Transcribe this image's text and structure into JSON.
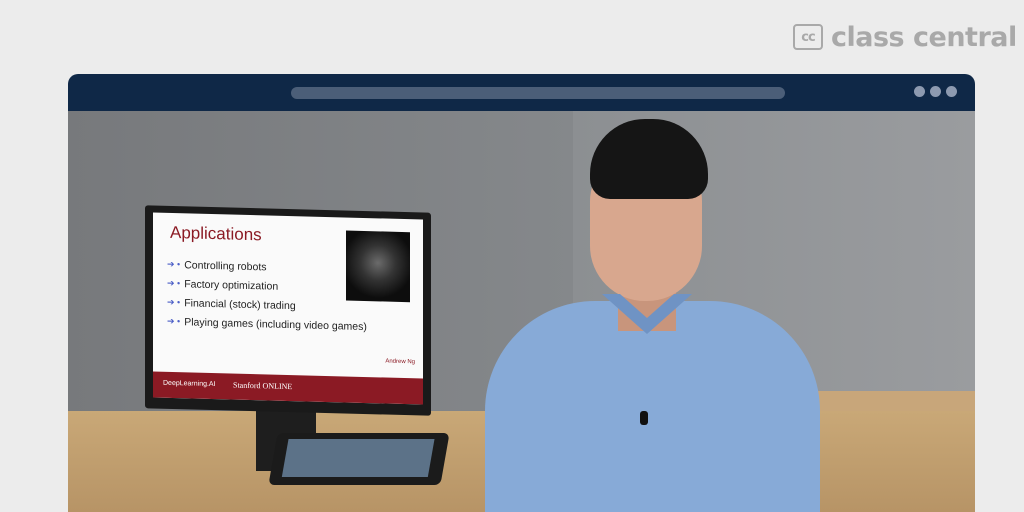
{
  "logo": {
    "mark": "cc",
    "name": "class central"
  },
  "slide": {
    "title": "Applications",
    "bullets": [
      "Controlling robots",
      "Factory optimization",
      "Financial (stock) trading",
      "Playing games (including video games)"
    ],
    "footer_left": "DeepLearning.AI",
    "footer_right": "Stanford ONLINE",
    "presenter": "Andrew Ng"
  },
  "colors": {
    "titlebar": "#0f2847",
    "slide_accent": "#8b1a24"
  }
}
